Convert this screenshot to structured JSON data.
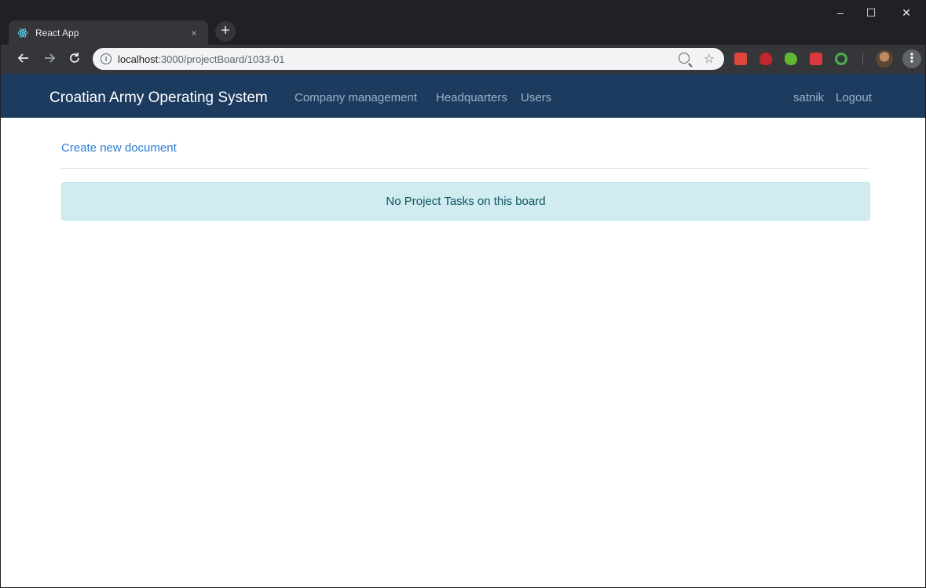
{
  "browser": {
    "tab_title": "React App",
    "tab_close": "×",
    "new_tab": "+",
    "url_host": "localhost",
    "url_path": ":3000/projectBoard/1033-01",
    "icons": {
      "favicon": "react-icon",
      "back": "back-arrow-icon",
      "forward": "forward-arrow-icon",
      "reload": "reload-icon",
      "info": "info-icon",
      "zoom": "zoom-icon",
      "star": "bookmark-star-icon",
      "menu": "kebab-menu-icon"
    },
    "window_controls": {
      "minimize": "–",
      "maximize": "☐",
      "close": "✕"
    },
    "extension_colors": [
      "#e0453b",
      "#c2272d",
      "#5fb832",
      "#d9393e",
      "#4caf50"
    ]
  },
  "navbar": {
    "brand": "Croatian Army Operating System",
    "links": [
      "Company management",
      "Headquarters",
      "Users"
    ],
    "user": "satnik",
    "logout": "Logout",
    "bg_color": "#1d3b5f"
  },
  "main": {
    "create_link": "Create new document",
    "empty_message": "No Project Tasks on this board"
  }
}
